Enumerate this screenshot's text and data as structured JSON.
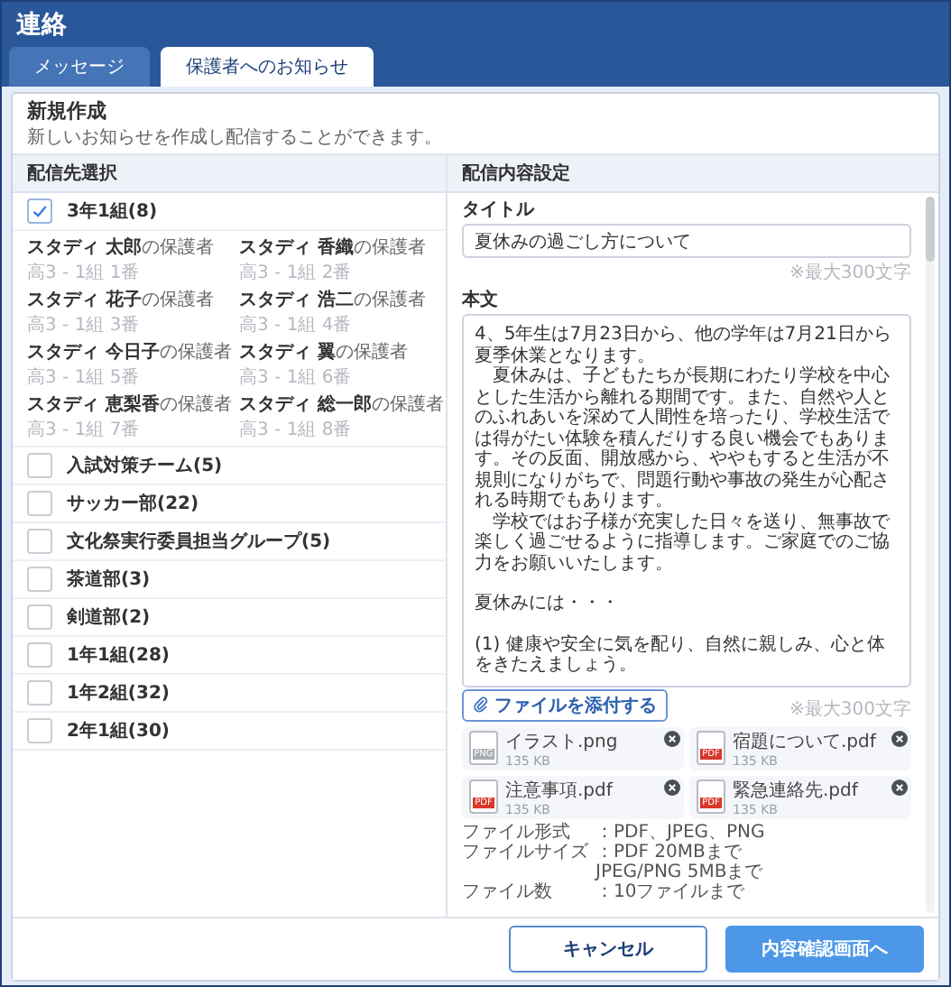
{
  "header": {
    "title": "連絡"
  },
  "tabs": [
    {
      "label": "メッセージ",
      "selected": false
    },
    {
      "label": "保護者へのお知らせ",
      "selected": true
    }
  ],
  "form": {
    "title": "新規作成",
    "subtitle": "新しいお知らせを作成し配信することができます。"
  },
  "recipients": {
    "heading": "配信先選択",
    "groups": [
      {
        "label": "3年1組(8)",
        "checked": true,
        "members": [
          {
            "name": "**スタディ 太郎**の保護者",
            "detail": "高3 - 1組 1番"
          },
          {
            "name": "**スタディ 香織**の保護者",
            "detail": "高3 - 1組 2番"
          },
          {
            "name": "**スタディ 花子**の保護者",
            "detail": "高3 - 1組 3番"
          },
          {
            "name": "**スタディ 浩二**の保護者",
            "detail": "高3 - 1組 4番"
          },
          {
            "name": "**スタディ 今日子**の保護者",
            "detail": "高3 - 1組 5番"
          },
          {
            "name": "**スタディ 翼**の保護者",
            "detail": "高3 - 1組 6番"
          },
          {
            "name": "**スタディ 恵梨香**の保護者",
            "detail": "高3 - 1組 7番"
          },
          {
            "name": "**スタディ 総一郎**の保護者",
            "detail": "高3 - 1組 8番"
          }
        ]
      },
      {
        "label": "入試対策チーム(5)",
        "checked": false
      },
      {
        "label": "サッカー部(22)",
        "checked": false
      },
      {
        "label": "文化祭実行委員担当グループ(5)",
        "checked": false
      },
      {
        "label": "茶道部(3)",
        "checked": false
      },
      {
        "label": "剣道部(2)",
        "checked": false
      },
      {
        "label": "1年1組(28)",
        "checked": false
      },
      {
        "label": "1年2組(32)",
        "checked": false
      },
      {
        "label": "2年1組(30)",
        "checked": false
      }
    ]
  },
  "content": {
    "heading": "配信内容設定",
    "title_label": "タイトル",
    "title_value": "夏休みの過ごし方について",
    "title_limit": "※最大300文字",
    "body_label": "本文",
    "body_paragraphs": [
      {
        "text": "4、5年生は7月23日から、他の学年は7月21日から夏季休業となります。",
        "spaced": false,
        "indented": false
      },
      {
        "text": "夏休みは、子どもたちが長期にわたり学校を中心とした生活から離れる期間です。また、自然や人とのふれあいを深めて人間性を培ったり、学校生活では得がたい体験を積んだりする良い機会でもあります。その反面、開放感から、ややもすると生活が不規則になりがちで、問題行動や事故の発生が心配される時期でもあります。",
        "spaced": false,
        "indented": true
      },
      {
        "text": "学校ではお子様が充実した日々を送り、無事故で楽しく過ごせるように指導します。ご家庭でのご協力をお願いいたします。",
        "spaced": false,
        "indented": true
      },
      {
        "text": "夏休みには・・・",
        "spaced": true,
        "indented": false
      },
      {
        "text": "(1) 健康や安全に気を配り、自然に親しみ、心と体をきたえましょう。",
        "spaced": true,
        "indented": false
      }
    ],
    "attach_button": "ファイルを添付する",
    "body_limit": "※最大300文字",
    "attachments": [
      {
        "name": "イラスト.png",
        "size": "135 KB",
        "kind": "png",
        "badge": "PNG"
      },
      {
        "name": "宿題について.pdf",
        "size": "135 KB",
        "kind": "pdf",
        "badge": "PDF"
      },
      {
        "name": "注意事項.pdf",
        "size": "135 KB",
        "kind": "pdf",
        "badge": "PDF"
      },
      {
        "name": "緊急連絡先.pdf",
        "size": "135 KB",
        "kind": "pdf",
        "badge": "PDF"
      }
    ],
    "notes": [
      {
        "label": "ファイル形式",
        "lines": [
          "：PDF、JPEG、PNG"
        ]
      },
      {
        "label": "ファイルサイズ",
        "lines": [
          "：PDF 20MBまで",
          "JPEG/PNG 5MBまで"
        ]
      },
      {
        "label": "ファイル数",
        "lines": [
          "：10ファイルまで"
        ]
      }
    ]
  },
  "footer": {
    "buttons": [
      {
        "label": "キャンセル",
        "kind": "secondary"
      },
      {
        "label": "内容確認画面へ",
        "kind": "primary"
      }
    ]
  }
}
